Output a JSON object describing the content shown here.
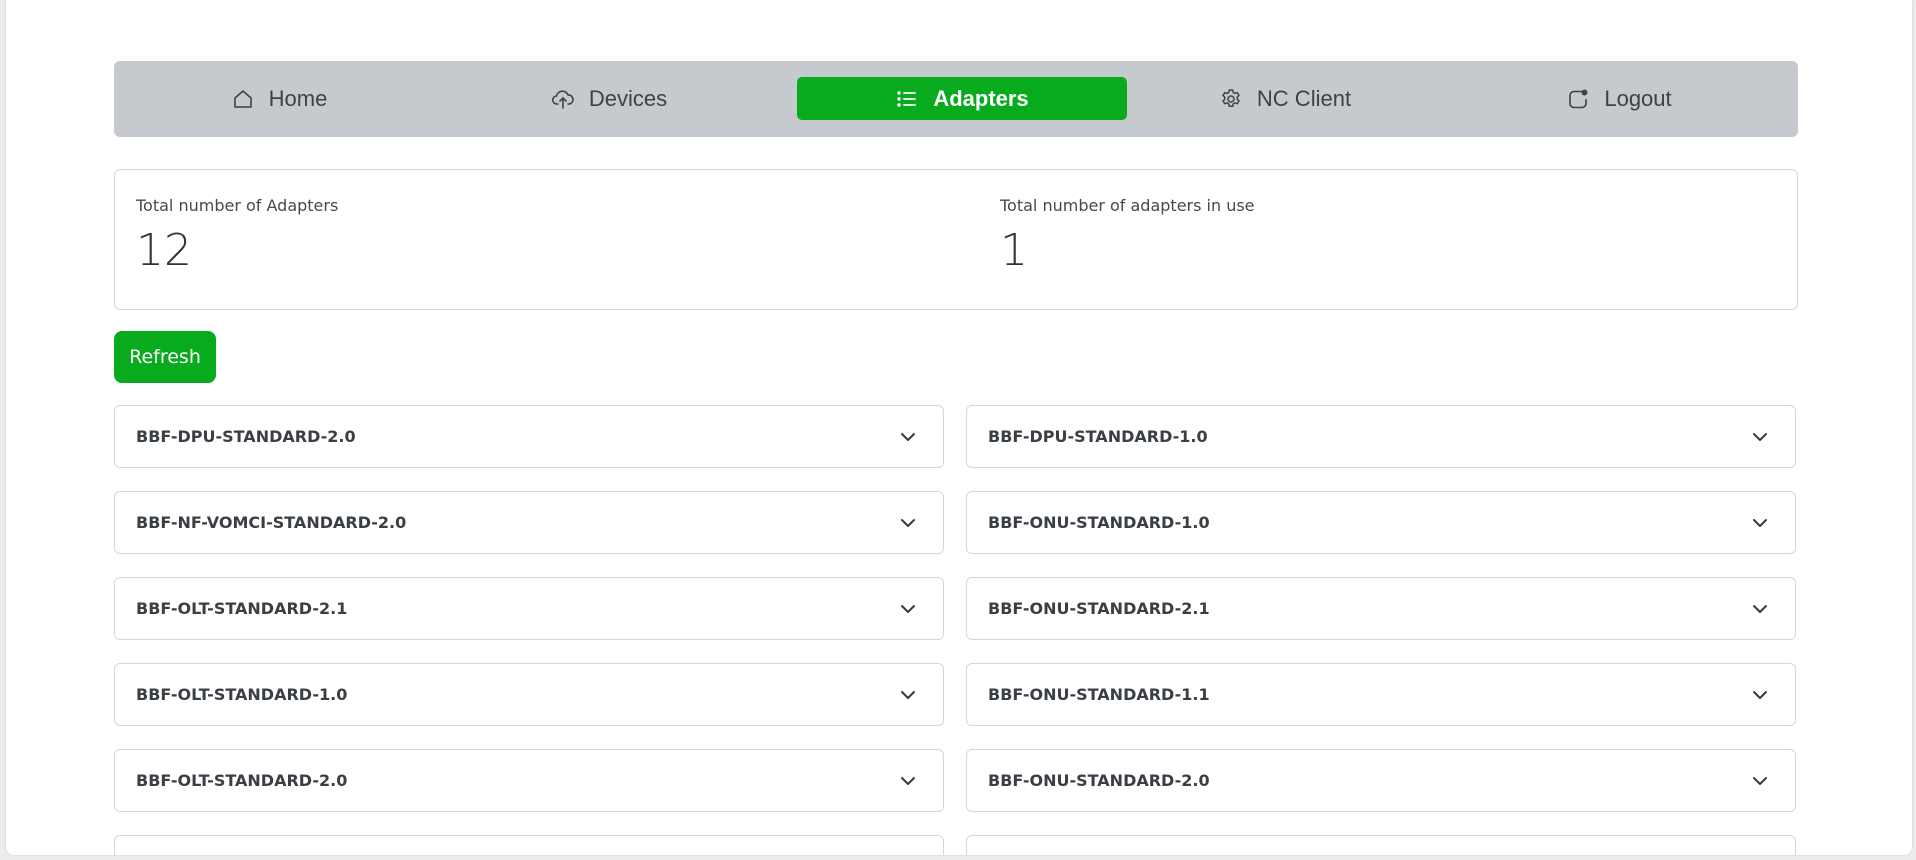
{
  "nav": {
    "items": [
      {
        "label": "Home",
        "icon": "home-icon"
      },
      {
        "label": "Devices",
        "icon": "cloud-upload-icon"
      },
      {
        "label": "Adapters",
        "icon": "list-icon",
        "active": true
      },
      {
        "label": "NC Client",
        "icon": "gear-icon"
      },
      {
        "label": "Logout",
        "icon": "logout-icon"
      }
    ],
    "active_color": "#08ab1e",
    "bar_color": "#c6c9cd"
  },
  "stats": {
    "total_label": "Total number of Adapters",
    "total_value": "12",
    "in_use_label": "Total number of adapters in use",
    "in_use_value": "1"
  },
  "toolbar": {
    "refresh_label": "Refresh"
  },
  "adapters": [
    "BBF-DPU-STANDARD-2.0",
    "BBF-DPU-STANDARD-1.0",
    "BBF-NF-VOMCI-STANDARD-2.0",
    "BBF-ONU-STANDARD-1.0",
    "BBF-OLT-STANDARD-2.1",
    "BBF-ONU-STANDARD-2.1",
    "BBF-OLT-STANDARD-1.0",
    "BBF-ONU-STANDARD-1.1",
    "BBF-OLT-STANDARD-2.0",
    "BBF-ONU-STANDARD-2.0",
    "",
    ""
  ]
}
